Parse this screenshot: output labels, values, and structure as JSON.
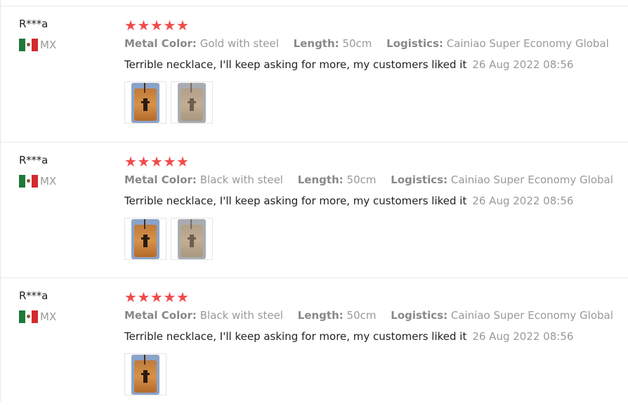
{
  "reviews": [
    {
      "user": "R***a",
      "country": "MX",
      "rating": 5,
      "metal_color_label": "Metal Color:",
      "metal_color": "Gold with steel",
      "length_label": "Length:",
      "length": "50cm",
      "logistics_label": "Logistics:",
      "logistics": "Cainiao Super Economy Global",
      "text": "Terrible necklace, I'll keep asking for more, my customers liked it",
      "date": "26 Aug 2022 08:56",
      "images": [
        "necklace-photo",
        "necklace-photo-faded"
      ]
    },
    {
      "user": "R***a",
      "country": "MX",
      "rating": 5,
      "metal_color_label": "Metal Color:",
      "metal_color": "Black with steel",
      "length_label": "Length:",
      "length": "50cm",
      "logistics_label": "Logistics:",
      "logistics": "Cainiao Super Economy Global",
      "text": "Terrible necklace, I'll keep asking for more, my customers liked it",
      "date": "26 Aug 2022 08:56",
      "images": [
        "necklace-photo",
        "necklace-photo-faded"
      ]
    },
    {
      "user": "R***a",
      "country": "MX",
      "rating": 5,
      "metal_color_label": "Metal Color:",
      "metal_color": "Black with steel",
      "length_label": "Length:",
      "length": "50cm",
      "logistics_label": "Logistics:",
      "logistics": "Cainiao Super Economy Global",
      "text": "Terrible necklace, I'll keep asking for more, my customers liked it",
      "date": "26 Aug 2022 08:56",
      "images": [
        "necklace-photo"
      ]
    }
  ],
  "colors": {
    "star": "#f04b4b",
    "muted": "#999999",
    "text": "#222222",
    "divider": "#e8e8e8"
  },
  "icons": {
    "star": "star-icon",
    "flag": "mexico-flag-icon"
  }
}
